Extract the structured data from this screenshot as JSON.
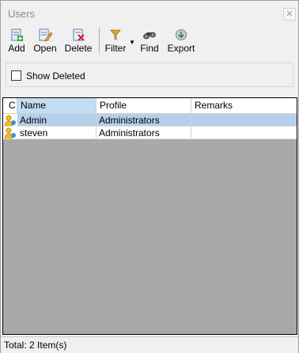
{
  "window": {
    "title": "Users"
  },
  "toolbar": {
    "buttons": [
      {
        "label": "Add",
        "icon": "add-icon"
      },
      {
        "label": "Open",
        "icon": "open-icon"
      },
      {
        "label": "Delete",
        "icon": "delete-icon"
      },
      {
        "label": "Filter",
        "icon": "filter-icon"
      },
      {
        "label": "Find",
        "icon": "find-icon"
      },
      {
        "label": "Export",
        "icon": "export-icon"
      }
    ]
  },
  "options": {
    "show_deleted_label": "Show Deleted",
    "show_deleted_checked": false
  },
  "grid": {
    "columns": [
      "C",
      "Name",
      "Profile",
      "Remarks"
    ],
    "rows": [
      {
        "name": "Admin",
        "profile": "Administrators",
        "remarks": ""
      },
      {
        "name": "steven",
        "profile": "Administrators",
        "remarks": ""
      }
    ]
  },
  "status": {
    "text": "Total: 2 Item(s)"
  },
  "colors": {
    "selection": "#b6cfeb",
    "sorted_header": "#c4ddf3",
    "grid_background": "#a9a9a9"
  }
}
